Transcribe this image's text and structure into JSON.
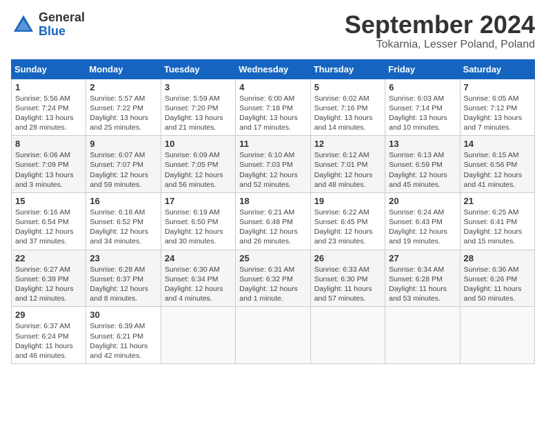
{
  "header": {
    "logo_general": "General",
    "logo_blue": "Blue",
    "month_title": "September 2024",
    "location": "Tokarnia, Lesser Poland, Poland"
  },
  "days_of_week": [
    "Sunday",
    "Monday",
    "Tuesday",
    "Wednesday",
    "Thursday",
    "Friday",
    "Saturday"
  ],
  "weeks": [
    [
      {
        "day": "1",
        "info": "Sunrise: 5:56 AM\nSunset: 7:24 PM\nDaylight: 13 hours\nand 28 minutes."
      },
      {
        "day": "2",
        "info": "Sunrise: 5:57 AM\nSunset: 7:22 PM\nDaylight: 13 hours\nand 25 minutes."
      },
      {
        "day": "3",
        "info": "Sunrise: 5:59 AM\nSunset: 7:20 PM\nDaylight: 13 hours\nand 21 minutes."
      },
      {
        "day": "4",
        "info": "Sunrise: 6:00 AM\nSunset: 7:18 PM\nDaylight: 13 hours\nand 17 minutes."
      },
      {
        "day": "5",
        "info": "Sunrise: 6:02 AM\nSunset: 7:16 PM\nDaylight: 13 hours\nand 14 minutes."
      },
      {
        "day": "6",
        "info": "Sunrise: 6:03 AM\nSunset: 7:14 PM\nDaylight: 13 hours\nand 10 minutes."
      },
      {
        "day": "7",
        "info": "Sunrise: 6:05 AM\nSunset: 7:12 PM\nDaylight: 13 hours\nand 7 minutes."
      }
    ],
    [
      {
        "day": "8",
        "info": "Sunrise: 6:06 AM\nSunset: 7:09 PM\nDaylight: 13 hours\nand 3 minutes."
      },
      {
        "day": "9",
        "info": "Sunrise: 6:07 AM\nSunset: 7:07 PM\nDaylight: 12 hours\nand 59 minutes."
      },
      {
        "day": "10",
        "info": "Sunrise: 6:09 AM\nSunset: 7:05 PM\nDaylight: 12 hours\nand 56 minutes."
      },
      {
        "day": "11",
        "info": "Sunrise: 6:10 AM\nSunset: 7:03 PM\nDaylight: 12 hours\nand 52 minutes."
      },
      {
        "day": "12",
        "info": "Sunrise: 6:12 AM\nSunset: 7:01 PM\nDaylight: 12 hours\nand 48 minutes."
      },
      {
        "day": "13",
        "info": "Sunrise: 6:13 AM\nSunset: 6:59 PM\nDaylight: 12 hours\nand 45 minutes."
      },
      {
        "day": "14",
        "info": "Sunrise: 6:15 AM\nSunset: 6:56 PM\nDaylight: 12 hours\nand 41 minutes."
      }
    ],
    [
      {
        "day": "15",
        "info": "Sunrise: 6:16 AM\nSunset: 6:54 PM\nDaylight: 12 hours\nand 37 minutes."
      },
      {
        "day": "16",
        "info": "Sunrise: 6:18 AM\nSunset: 6:52 PM\nDaylight: 12 hours\nand 34 minutes."
      },
      {
        "day": "17",
        "info": "Sunrise: 6:19 AM\nSunset: 6:50 PM\nDaylight: 12 hours\nand 30 minutes."
      },
      {
        "day": "18",
        "info": "Sunrise: 6:21 AM\nSunset: 6:48 PM\nDaylight: 12 hours\nand 26 minutes."
      },
      {
        "day": "19",
        "info": "Sunrise: 6:22 AM\nSunset: 6:45 PM\nDaylight: 12 hours\nand 23 minutes."
      },
      {
        "day": "20",
        "info": "Sunrise: 6:24 AM\nSunset: 6:43 PM\nDaylight: 12 hours\nand 19 minutes."
      },
      {
        "day": "21",
        "info": "Sunrise: 6:25 AM\nSunset: 6:41 PM\nDaylight: 12 hours\nand 15 minutes."
      }
    ],
    [
      {
        "day": "22",
        "info": "Sunrise: 6:27 AM\nSunset: 6:39 PM\nDaylight: 12 hours\nand 12 minutes."
      },
      {
        "day": "23",
        "info": "Sunrise: 6:28 AM\nSunset: 6:37 PM\nDaylight: 12 hours\nand 8 minutes."
      },
      {
        "day": "24",
        "info": "Sunrise: 6:30 AM\nSunset: 6:34 PM\nDaylight: 12 hours\nand 4 minutes."
      },
      {
        "day": "25",
        "info": "Sunrise: 6:31 AM\nSunset: 6:32 PM\nDaylight: 12 hours\nand 1 minute."
      },
      {
        "day": "26",
        "info": "Sunrise: 6:33 AM\nSunset: 6:30 PM\nDaylight: 11 hours\nand 57 minutes."
      },
      {
        "day": "27",
        "info": "Sunrise: 6:34 AM\nSunset: 6:28 PM\nDaylight: 11 hours\nand 53 minutes."
      },
      {
        "day": "28",
        "info": "Sunrise: 6:36 AM\nSunset: 6:26 PM\nDaylight: 11 hours\nand 50 minutes."
      }
    ],
    [
      {
        "day": "29",
        "info": "Sunrise: 6:37 AM\nSunset: 6:24 PM\nDaylight: 11 hours\nand 46 minutes."
      },
      {
        "day": "30",
        "info": "Sunrise: 6:39 AM\nSunset: 6:21 PM\nDaylight: 11 hours\nand 42 minutes."
      },
      {
        "day": "",
        "info": ""
      },
      {
        "day": "",
        "info": ""
      },
      {
        "day": "",
        "info": ""
      },
      {
        "day": "",
        "info": ""
      },
      {
        "day": "",
        "info": ""
      }
    ]
  ]
}
